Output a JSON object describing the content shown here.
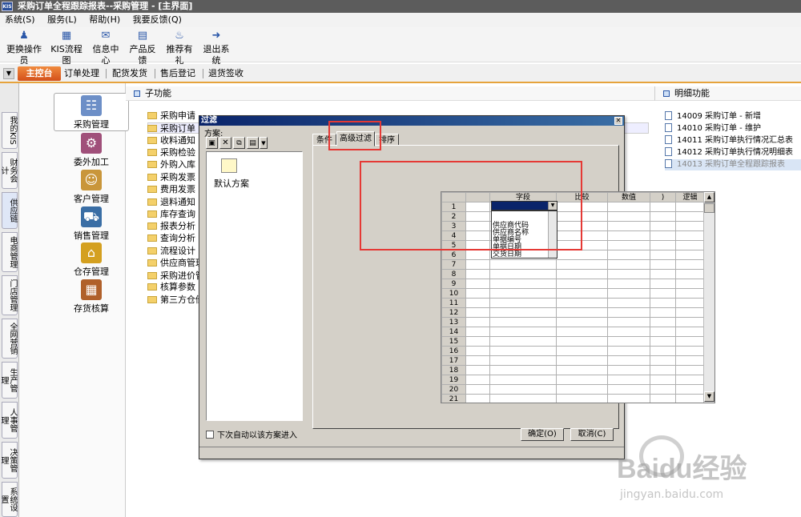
{
  "window": {
    "title": "采购订单全程跟踪报表--采购管理 - [主界面]",
    "app_icon": "KIS"
  },
  "menu": [
    "系统(S)",
    "服务(L)",
    "帮助(H)",
    "我要反馈(Q)"
  ],
  "toolbar": [
    {
      "label": "更换操作员",
      "icon": "user-switch-icon"
    },
    {
      "label": "KIS流程图",
      "icon": "flowchart-icon"
    },
    {
      "label": "信息中心",
      "icon": "message-icon"
    },
    {
      "label": "产品反馈",
      "icon": "feedback-icon"
    },
    {
      "label": "推荐有礼",
      "icon": "gift-icon"
    },
    {
      "label": "退出系统",
      "icon": "exit-icon"
    }
  ],
  "nav": {
    "main": "主控台",
    "items": [
      "订单处理",
      "配货发货",
      "售后登记",
      "退货签收"
    ]
  },
  "left_tabs": [
    "我的KIS",
    "财务会计",
    "供应链",
    "电商管理",
    "门店管理",
    "全网营销",
    "生产管理",
    "人事管理",
    "决策管理",
    "系统设置"
  ],
  "modules": [
    "采购管理",
    "委外加工",
    "客户管理",
    "销售管理",
    "仓存管理",
    "存货核算"
  ],
  "sub_panel": {
    "title": "子功能",
    "items": [
      "采购申请",
      "采购订单",
      "收料通知",
      "采购检验",
      "外购入库",
      "采购发票",
      "费用发票",
      "退料通知",
      "库存查询",
      "报表分析",
      "查询分析",
      "流程设计",
      "供应商管理",
      "采购进价管",
      "核算参数",
      "第三方仓储"
    ]
  },
  "detail_panel": {
    "title": "明细功能",
    "items": [
      "14009  采购订单 - 新增",
      "14010  采购订单 - 维护",
      "14011  采购订单执行情况汇总表",
      "14012  采购订单执行情况明细表",
      "14013  采购订单全程跟踪报表"
    ]
  },
  "dialog": {
    "title": "过滤",
    "plan_label": "方案:",
    "plan_toolbar": [
      "save-icon",
      "delete-icon",
      "copy-icon",
      "import-icon",
      "dropdown-icon"
    ],
    "default_plan": "默认方案",
    "tabs": [
      "条件",
      "高级过滤",
      "排序"
    ],
    "columns": [
      "字段",
      "比较",
      "数值",
      ")",
      "逻辑"
    ],
    "row_numbers": [
      "1",
      "2",
      "3",
      "4",
      "5",
      "6",
      "7",
      "8",
      "9",
      "10",
      "11",
      "12",
      "13",
      "14",
      "15",
      "16",
      "17",
      "18",
      "19",
      "20",
      "21"
    ],
    "field_options": [
      "供应商代码",
      "供应商名称",
      "单据编号",
      "单据日期",
      "交货日期"
    ],
    "auto_enter_label": "下次自动以该方案进入",
    "auto_enter_checked": false,
    "ok": "确定(O)",
    "cancel": "取消(C)"
  },
  "watermark": {
    "brand": "Baidu经验",
    "url": "jingyan.baidu.com"
  }
}
